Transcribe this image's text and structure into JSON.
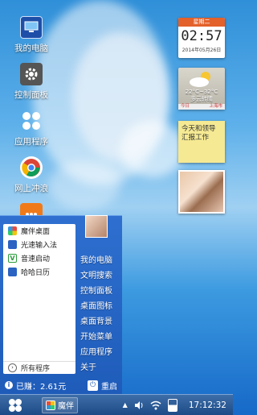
{
  "desktop_icons": [
    {
      "label": "我的电脑",
      "icon": "computer-icon"
    },
    {
      "label": "控制面板",
      "icon": "gear-icon"
    },
    {
      "label": "应用程序",
      "icon": "apps-grid-icon"
    },
    {
      "label": "网上冲浪",
      "icon": "chrome-icon"
    },
    {
      "label": "",
      "icon": "message-icon"
    }
  ],
  "clock_widget": {
    "weekday": "星期二",
    "time": "02:57",
    "date": "2014年05月26日"
  },
  "weather_widget": {
    "temp": "22°C~32°C",
    "desc": "多云转晴",
    "today": "今日",
    "city": "上海市",
    "icon": "cloud-sun-icon"
  },
  "note_widget": {
    "text": "今天和领导汇报工作"
  },
  "start_menu": {
    "apps": [
      {
        "label": "魔伴桌面",
        "icon": "pinwheel-icon",
        "color": "#e74c3c"
      },
      {
        "label": "光速输入法",
        "icon": "input-icon",
        "color": "#2a63c2"
      },
      {
        "label": "音速启动",
        "icon": "v-icon",
        "color": "#2a9d3b"
      },
      {
        "label": "哈哈日历",
        "icon": "calendar-icon",
        "color": "#2a63c2"
      }
    ],
    "all_programs": "所有程序",
    "right_items": [
      "我的电脑",
      "文明搜索",
      "控制面板",
      "桌面图标",
      "桌面背景",
      "开始菜单",
      "应用程序",
      "关于"
    ],
    "earned": "已赚：2.61元",
    "restart": "重启"
  },
  "taskbar": {
    "task_label": "魔伴",
    "time": "17:12:32"
  },
  "colors": {
    "accent": "#2a63c2",
    "taskbar": "#1c4a86"
  }
}
